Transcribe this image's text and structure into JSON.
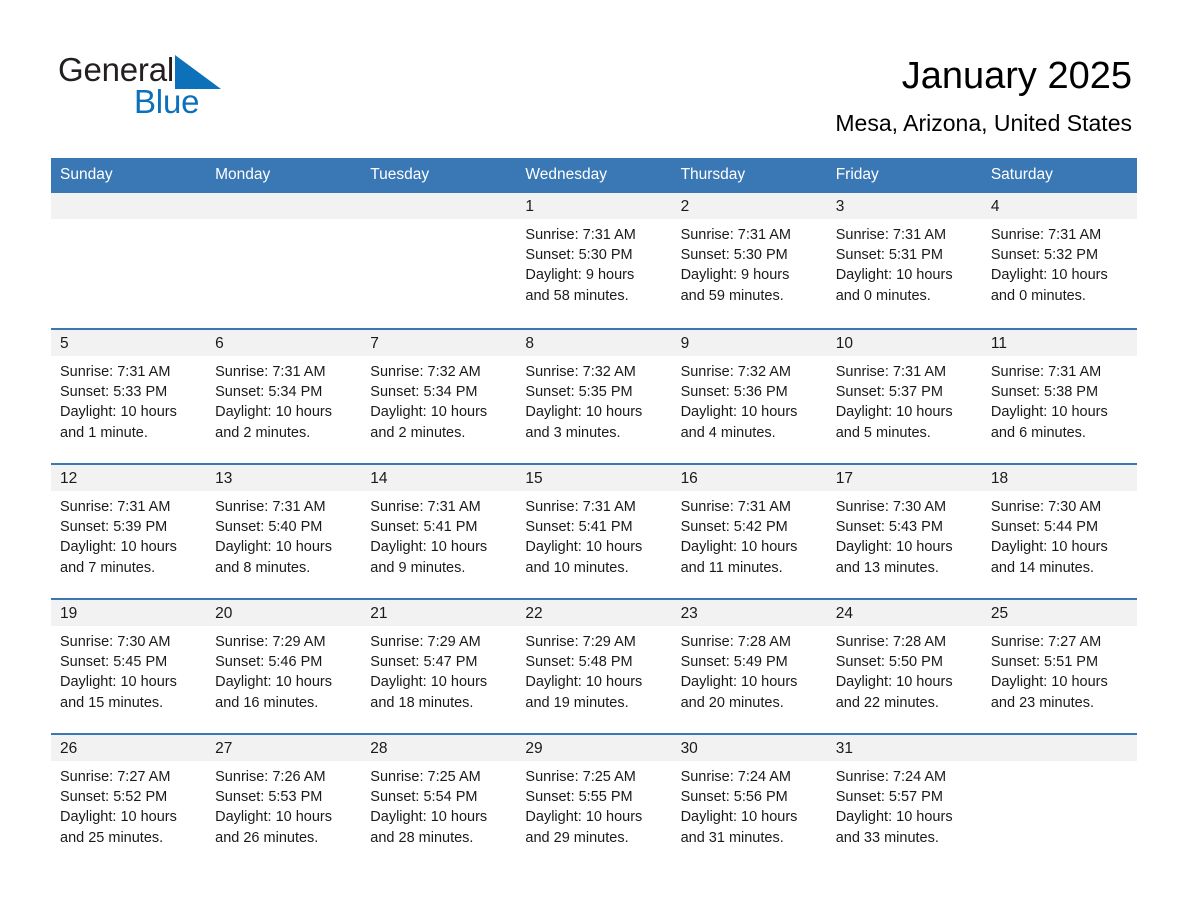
{
  "brand": {
    "name_part1": "General",
    "name_part2": "Blue",
    "triangle_color": "#0d71ba",
    "blue_color": "#0d71ba"
  },
  "header": {
    "title": "January 2025",
    "subtitle": "Mesa, Arizona, United States"
  },
  "theme": {
    "header_band": "#3a77b5",
    "daynum_band": "#f2f2f2",
    "text": "#1a1a1a"
  },
  "weekday_headers": [
    "Sunday",
    "Monday",
    "Tuesday",
    "Wednesday",
    "Thursday",
    "Friday",
    "Saturday"
  ],
  "weeks": [
    [
      {
        "day": "",
        "lines": []
      },
      {
        "day": "",
        "lines": []
      },
      {
        "day": "",
        "lines": []
      },
      {
        "day": "1",
        "lines": [
          "Sunrise: 7:31 AM",
          "Sunset: 5:30 PM",
          "Daylight: 9 hours",
          "and 58 minutes."
        ]
      },
      {
        "day": "2",
        "lines": [
          "Sunrise: 7:31 AM",
          "Sunset: 5:30 PM",
          "Daylight: 9 hours",
          "and 59 minutes."
        ]
      },
      {
        "day": "3",
        "lines": [
          "Sunrise: 7:31 AM",
          "Sunset: 5:31 PM",
          "Daylight: 10 hours",
          "and 0 minutes."
        ]
      },
      {
        "day": "4",
        "lines": [
          "Sunrise: 7:31 AM",
          "Sunset: 5:32 PM",
          "Daylight: 10 hours",
          "and 0 minutes."
        ]
      }
    ],
    [
      {
        "day": "5",
        "lines": [
          "Sunrise: 7:31 AM",
          "Sunset: 5:33 PM",
          "Daylight: 10 hours",
          "and 1 minute."
        ]
      },
      {
        "day": "6",
        "lines": [
          "Sunrise: 7:31 AM",
          "Sunset: 5:34 PM",
          "Daylight: 10 hours",
          "and 2 minutes."
        ]
      },
      {
        "day": "7",
        "lines": [
          "Sunrise: 7:32 AM",
          "Sunset: 5:34 PM",
          "Daylight: 10 hours",
          "and 2 minutes."
        ]
      },
      {
        "day": "8",
        "lines": [
          "Sunrise: 7:32 AM",
          "Sunset: 5:35 PM",
          "Daylight: 10 hours",
          "and 3 minutes."
        ]
      },
      {
        "day": "9",
        "lines": [
          "Sunrise: 7:32 AM",
          "Sunset: 5:36 PM",
          "Daylight: 10 hours",
          "and 4 minutes."
        ]
      },
      {
        "day": "10",
        "lines": [
          "Sunrise: 7:31 AM",
          "Sunset: 5:37 PM",
          "Daylight: 10 hours",
          "and 5 minutes."
        ]
      },
      {
        "day": "11",
        "lines": [
          "Sunrise: 7:31 AM",
          "Sunset: 5:38 PM",
          "Daylight: 10 hours",
          "and 6 minutes."
        ]
      }
    ],
    [
      {
        "day": "12",
        "lines": [
          "Sunrise: 7:31 AM",
          "Sunset: 5:39 PM",
          "Daylight: 10 hours",
          "and 7 minutes."
        ]
      },
      {
        "day": "13",
        "lines": [
          "Sunrise: 7:31 AM",
          "Sunset: 5:40 PM",
          "Daylight: 10 hours",
          "and 8 minutes."
        ]
      },
      {
        "day": "14",
        "lines": [
          "Sunrise: 7:31 AM",
          "Sunset: 5:41 PM",
          "Daylight: 10 hours",
          "and 9 minutes."
        ]
      },
      {
        "day": "15",
        "lines": [
          "Sunrise: 7:31 AM",
          "Sunset: 5:41 PM",
          "Daylight: 10 hours",
          "and 10 minutes."
        ]
      },
      {
        "day": "16",
        "lines": [
          "Sunrise: 7:31 AM",
          "Sunset: 5:42 PM",
          "Daylight: 10 hours",
          "and 11 minutes."
        ]
      },
      {
        "day": "17",
        "lines": [
          "Sunrise: 7:30 AM",
          "Sunset: 5:43 PM",
          "Daylight: 10 hours",
          "and 13 minutes."
        ]
      },
      {
        "day": "18",
        "lines": [
          "Sunrise: 7:30 AM",
          "Sunset: 5:44 PM",
          "Daylight: 10 hours",
          "and 14 minutes."
        ]
      }
    ],
    [
      {
        "day": "19",
        "lines": [
          "Sunrise: 7:30 AM",
          "Sunset: 5:45 PM",
          "Daylight: 10 hours",
          "and 15 minutes."
        ]
      },
      {
        "day": "20",
        "lines": [
          "Sunrise: 7:29 AM",
          "Sunset: 5:46 PM",
          "Daylight: 10 hours",
          "and 16 minutes."
        ]
      },
      {
        "day": "21",
        "lines": [
          "Sunrise: 7:29 AM",
          "Sunset: 5:47 PM",
          "Daylight: 10 hours",
          "and 18 minutes."
        ]
      },
      {
        "day": "22",
        "lines": [
          "Sunrise: 7:29 AM",
          "Sunset: 5:48 PM",
          "Daylight: 10 hours",
          "and 19 minutes."
        ]
      },
      {
        "day": "23",
        "lines": [
          "Sunrise: 7:28 AM",
          "Sunset: 5:49 PM",
          "Daylight: 10 hours",
          "and 20 minutes."
        ]
      },
      {
        "day": "24",
        "lines": [
          "Sunrise: 7:28 AM",
          "Sunset: 5:50 PM",
          "Daylight: 10 hours",
          "and 22 minutes."
        ]
      },
      {
        "day": "25",
        "lines": [
          "Sunrise: 7:27 AM",
          "Sunset: 5:51 PM",
          "Daylight: 10 hours",
          "and 23 minutes."
        ]
      }
    ],
    [
      {
        "day": "26",
        "lines": [
          "Sunrise: 7:27 AM",
          "Sunset: 5:52 PM",
          "Daylight: 10 hours",
          "and 25 minutes."
        ]
      },
      {
        "day": "27",
        "lines": [
          "Sunrise: 7:26 AM",
          "Sunset: 5:53 PM",
          "Daylight: 10 hours",
          "and 26 minutes."
        ]
      },
      {
        "day": "28",
        "lines": [
          "Sunrise: 7:25 AM",
          "Sunset: 5:54 PM",
          "Daylight: 10 hours",
          "and 28 minutes."
        ]
      },
      {
        "day": "29",
        "lines": [
          "Sunrise: 7:25 AM",
          "Sunset: 5:55 PM",
          "Daylight: 10 hours",
          "and 29 minutes."
        ]
      },
      {
        "day": "30",
        "lines": [
          "Sunrise: 7:24 AM",
          "Sunset: 5:56 PM",
          "Daylight: 10 hours",
          "and 31 minutes."
        ]
      },
      {
        "day": "31",
        "lines": [
          "Sunrise: 7:24 AM",
          "Sunset: 5:57 PM",
          "Daylight: 10 hours",
          "and 33 minutes."
        ]
      },
      {
        "day": "",
        "lines": []
      }
    ]
  ]
}
